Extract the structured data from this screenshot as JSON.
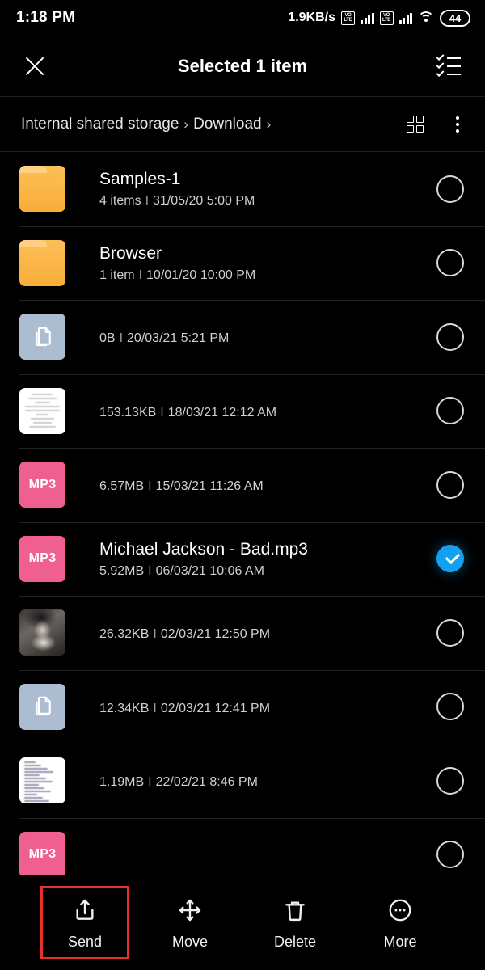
{
  "statusbar": {
    "time": "1:18 PM",
    "net_speed": "1.9KB/s",
    "volte_label": "VO LTE",
    "battery": "44",
    "icons": [
      "volte-icon",
      "signal-bars-icon",
      "volte-icon",
      "signal-bars-icon",
      "wifi-icon",
      "battery-icon"
    ]
  },
  "actionbar": {
    "close_label": "close-icon",
    "title": "Selected 1 item",
    "select_all_label": "select-all-icon"
  },
  "breadcrumb": {
    "items": [
      "Internal shared storage",
      "Download"
    ],
    "separator": "›",
    "grid_view_label": "grid-view-icon",
    "overflow_label": "more-options-icon"
  },
  "files": [
    {
      "name": "Samples-1",
      "redacted": false,
      "size": "4 items",
      "date": "31/05/20 5:00 PM",
      "icon": "folder",
      "selected": false
    },
    {
      "name": "Browser",
      "redacted": false,
      "size": "1 item",
      "date": "10/01/20 10:00 PM",
      "icon": "folder",
      "selected": false
    },
    {
      "name": "",
      "redacted": true,
      "size": "0B",
      "date": "20/03/21 5:21 PM",
      "icon": "doc",
      "selected": false
    },
    {
      "name": "",
      "redacted": true,
      "size": "153.13KB",
      "date": "18/03/21 12:12 AM",
      "icon": "cert",
      "selected": false
    },
    {
      "name": "",
      "redacted": true,
      "size": "6.57MB",
      "date": "15/03/21 11:26 AM",
      "icon": "mp3",
      "selected": false
    },
    {
      "name": "Michael Jackson - Bad.mp3",
      "redacted": false,
      "size": "5.92MB",
      "date": "06/03/21 10:06 AM",
      "icon": "mp3",
      "selected": true
    },
    {
      "name": "",
      "redacted": true,
      "size": "26.32KB",
      "date": "02/03/21 12:50 PM",
      "icon": "photo",
      "selected": false
    },
    {
      "name": "",
      "redacted": true,
      "size": "12.34KB",
      "date": "02/03/21 12:41 PM",
      "icon": "doc",
      "selected": false
    },
    {
      "name": "",
      "redacted": true,
      "size": "1.19MB",
      "date": "22/02/21 8:46 PM",
      "icon": "sheet",
      "selected": false
    },
    {
      "name": "",
      "redacted": true,
      "size": "",
      "date": "",
      "icon": "mp3",
      "selected": false
    }
  ],
  "file_meta_separator": "I",
  "mp3_badge": "MP3",
  "bottombar": {
    "actions": [
      {
        "label": "Send",
        "icon": "share-icon",
        "highlighted": true
      },
      {
        "label": "Move",
        "icon": "move-icon",
        "highlighted": false
      },
      {
        "label": "Delete",
        "icon": "trash-icon",
        "highlighted": false
      },
      {
        "label": "More",
        "icon": "more-icon",
        "highlighted": false
      }
    ]
  },
  "colors": {
    "background": "#000000",
    "accent_selected": "#13a0f0",
    "folder": "#f9ad38",
    "mp3": "#ef5f90",
    "doc": "#adbdd1",
    "highlight_box": "#e8312f"
  }
}
